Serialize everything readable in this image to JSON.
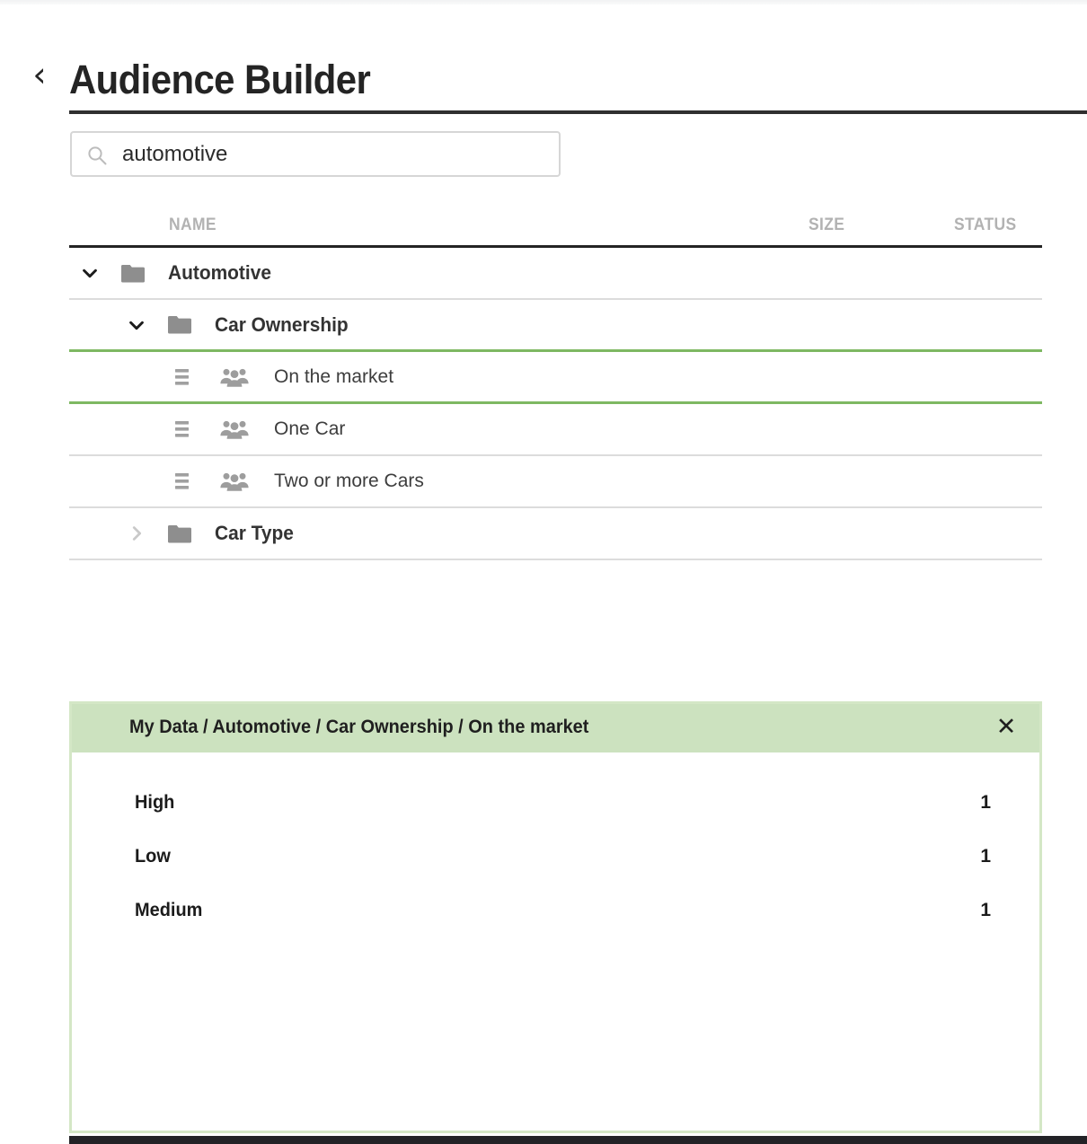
{
  "header": {
    "back_icon": "chevron-left-icon",
    "title": "Audience Builder"
  },
  "search": {
    "icon": "search-icon",
    "value": "automotive",
    "placeholder": "Search"
  },
  "table": {
    "columns": [
      "NAME",
      "SIZE",
      "STATUS"
    ],
    "rows": [
      {
        "label": "Automotive",
        "depth": 0,
        "type": "folder",
        "icon": "folder-icon",
        "twisty": "chevron-down-icon",
        "expanded": true,
        "selected": false,
        "size": "",
        "status": ""
      },
      {
        "label": "Car Ownership",
        "depth": 1,
        "type": "folder",
        "icon": "folder-icon",
        "twisty": "chevron-down-icon",
        "expanded": true,
        "selected": false,
        "size": "",
        "status": ""
      },
      {
        "label": "On the market",
        "depth": 2,
        "type": "segment",
        "icon": "people-group-icon",
        "handle": "drag-handle-icon",
        "selected": true,
        "size": "",
        "status": ""
      },
      {
        "label": "One Car",
        "depth": 2,
        "type": "segment",
        "icon": "people-group-icon",
        "handle": "drag-handle-icon",
        "selected": false,
        "size": "",
        "status": ""
      },
      {
        "label": "Two or more Cars",
        "depth": 2,
        "type": "segment",
        "icon": "people-group-icon",
        "handle": "drag-handle-icon",
        "selected": false,
        "size": "",
        "status": ""
      },
      {
        "label": "Car Type",
        "depth": 1,
        "type": "folder",
        "icon": "folder-icon",
        "twisty": "chevron-right-icon",
        "expanded": false,
        "selected": false,
        "size": "",
        "status": ""
      }
    ]
  },
  "detail_panel": {
    "breadcrumb": "My Data / Automotive / Car Ownership / On the market",
    "close_icon": "close-icon",
    "stats": [
      {
        "label": "High",
        "value": "1"
      },
      {
        "label": "Low",
        "value": "1"
      },
      {
        "label": "Medium",
        "value": "1"
      }
    ]
  },
  "colors": {
    "accent_green": "#7eb862",
    "panel_header_green": "#cce2bf",
    "panel_border_green": "#d4e7c6",
    "rule_dark": "#242424",
    "row_divider": "#dcdcdc",
    "icon_gray": "#9e9e9e",
    "header_text_gray": "#b2b2b2",
    "bottom_bar": "#222226"
  }
}
